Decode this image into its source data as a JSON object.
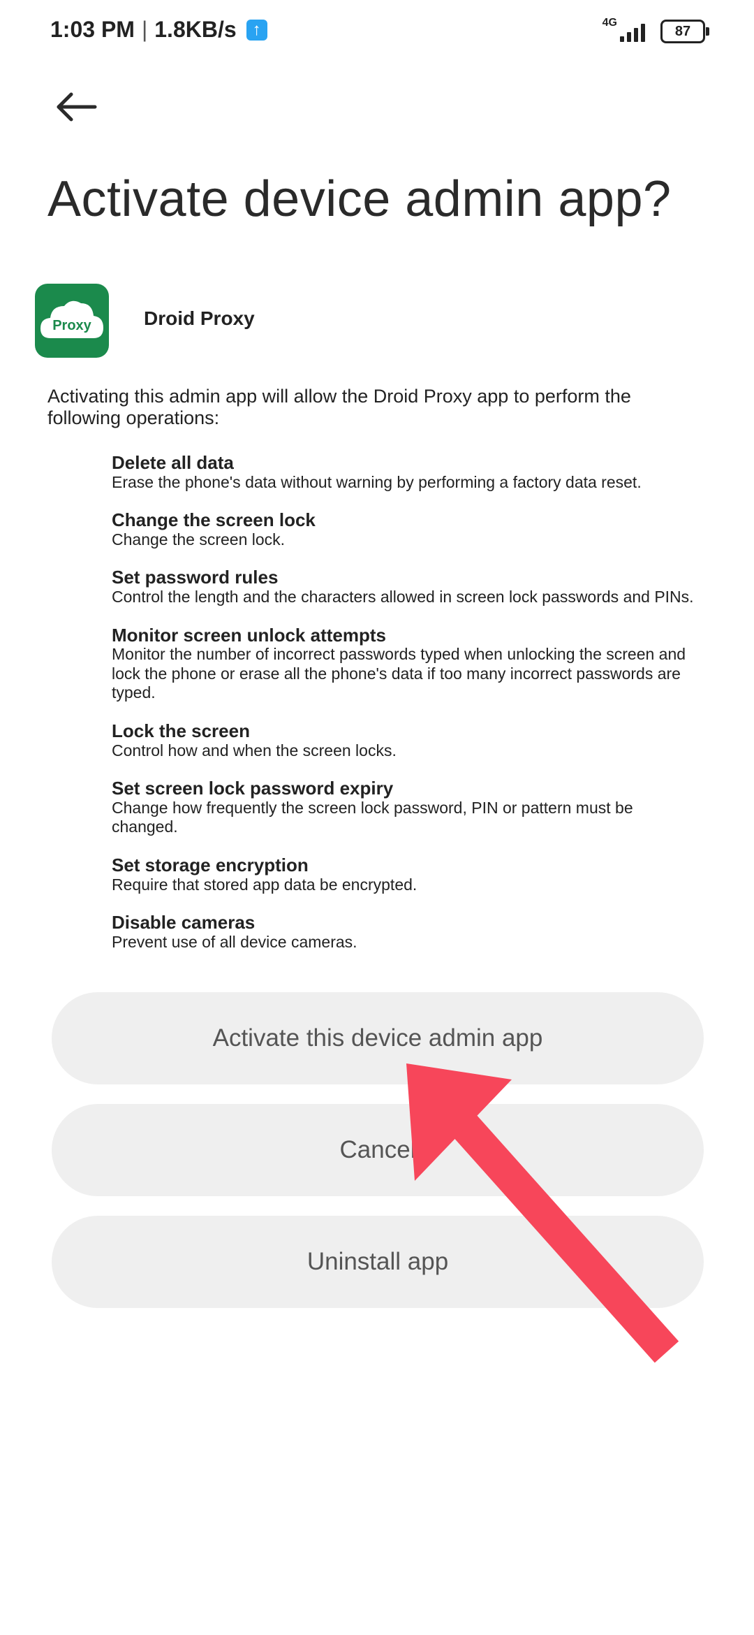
{
  "status_bar": {
    "time": "1:03 PM",
    "separator": "|",
    "net_speed": "1.8KB/s",
    "upload_icon": "upload-arrow-icon",
    "network_type": "4G",
    "battery_level": "87"
  },
  "header": {
    "back_icon": "back-arrow-icon",
    "title": "Activate device admin app?"
  },
  "app": {
    "icon_text": "Proxy",
    "icon_color": "#1b8a4c",
    "name": "Droid Proxy"
  },
  "intro": "Activating this admin app will allow the Droid Proxy app to perform the following operations:",
  "permissions": [
    {
      "title": "Delete all data",
      "desc": "Erase the phone's data without warning by performing a factory data reset."
    },
    {
      "title": "Change the screen lock",
      "desc": "Change the screen lock."
    },
    {
      "title": "Set password rules",
      "desc": "Control the length and the characters allowed in screen lock passwords and PINs."
    },
    {
      "title": "Monitor screen unlock attempts",
      "desc": "Monitor the number of incorrect passwords typed when unlocking the screen and lock the phone or erase all the phone's data if too many incorrect passwords are typed."
    },
    {
      "title": "Lock the screen",
      "desc": "Control how and when the screen locks."
    },
    {
      "title": "Set screen lock password expiry",
      "desc": "Change how frequently the screen lock password, PIN or pattern must be changed."
    },
    {
      "title": "Set storage encryption",
      "desc": "Require that stored app data be encrypted."
    },
    {
      "title": "Disable cameras",
      "desc": "Prevent use of all device cameras."
    }
  ],
  "buttons": {
    "activate": "Activate this device admin app",
    "cancel": "Cancel",
    "uninstall": "Uninstall app"
  },
  "colors": {
    "accent_arrow": "#f7465a",
    "button_bg": "#efefef",
    "upload_badge": "#29a3f2"
  }
}
